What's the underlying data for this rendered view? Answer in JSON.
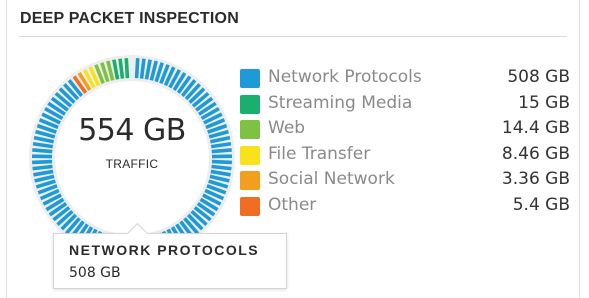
{
  "widget": {
    "title": "DEEP PACKET INSPECTION"
  },
  "donut": {
    "total_value": "554 GB",
    "total_label": "TRAFFIC"
  },
  "chart_data": {
    "type": "pie",
    "categories": [
      "Network Protocols",
      "Streaming Media",
      "Web",
      "File Transfer",
      "Social Network",
      "Other"
    ],
    "values": [
      508,
      15,
      14.4,
      8.46,
      3.36,
      5.4
    ],
    "colors": [
      "#1e9bd7",
      "#1aae6f",
      "#7dc242",
      "#f7e21b",
      "#f29e1f",
      "#f26c21"
    ]
  },
  "legend": [
    {
      "label": "Network Protocols",
      "value": "508 GB",
      "color": "#1e9bd7"
    },
    {
      "label": "Streaming Media",
      "value": "15 GB",
      "color": "#1aae6f"
    },
    {
      "label": "Web",
      "value": "14.4 GB",
      "color": "#7dc242"
    },
    {
      "label": "File Transfer",
      "value": "8.46 GB",
      "color": "#f7e21b"
    },
    {
      "label": "Social Network",
      "value": "3.36 GB",
      "color": "#f29e1f"
    },
    {
      "label": "Other",
      "value": "5.4 GB",
      "color": "#f26c21"
    }
  ],
  "tooltip": {
    "title": "NETWORK PROTOCOLS",
    "value": "508 GB"
  }
}
